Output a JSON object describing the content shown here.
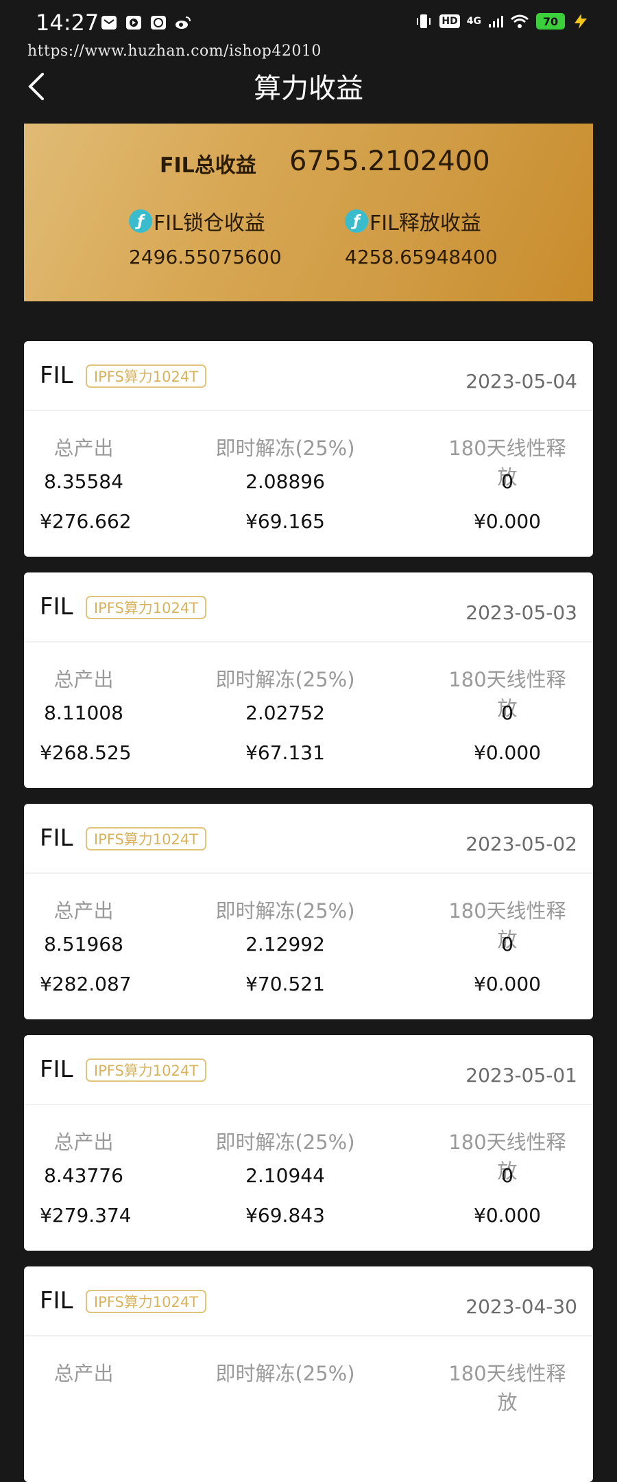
{
  "status_bar": {
    "time": "14:27",
    "signal_label": "4G",
    "hd_label": "HD",
    "battery": "70"
  },
  "watermark_url": "https://www.huzhan.com/ishop42010",
  "header": {
    "title": "算力收益"
  },
  "summary": {
    "total_label": "FIL总收益",
    "total_value": "6755.2102400",
    "locked_label": "FIL锁仓收益",
    "locked_value": "2496.55075600",
    "released_label": "FIL释放收益",
    "released_value": "4258.65948400",
    "coin_glyph": "ƒ"
  },
  "columns": {
    "total": "总产出",
    "instant": "即时解冻(25%)",
    "linear": "180天线性释放"
  },
  "cards": [
    {
      "coin": "FIL",
      "tag": "IPFS算力1024T",
      "date": "2023-05-04",
      "total": "8.35584",
      "instant": "2.08896",
      "linear": "0",
      "total_cny": "¥276.662",
      "instant_cny": "¥69.165",
      "linear_cny": "¥0.000"
    },
    {
      "coin": "FIL",
      "tag": "IPFS算力1024T",
      "date": "2023-05-03",
      "total": "8.11008",
      "instant": "2.02752",
      "linear": "0",
      "total_cny": "¥268.525",
      "instant_cny": "¥67.131",
      "linear_cny": "¥0.000"
    },
    {
      "coin": "FIL",
      "tag": "IPFS算力1024T",
      "date": "2023-05-02",
      "total": "8.51968",
      "instant": "2.12992",
      "linear": "0",
      "total_cny": "¥282.087",
      "instant_cny": "¥70.521",
      "linear_cny": "¥0.000"
    },
    {
      "coin": "FIL",
      "tag": "IPFS算力1024T",
      "date": "2023-05-01",
      "total": "8.43776",
      "instant": "2.10944",
      "linear": "0",
      "total_cny": "¥279.374",
      "instant_cny": "¥69.843",
      "linear_cny": "¥0.000"
    },
    {
      "coin": "FIL",
      "tag": "IPFS算力1024T",
      "date": "2023-04-30"
    }
  ],
  "colors": {
    "background": "#181818",
    "gold_start": "#e0bb75",
    "gold_end": "#c98c2c",
    "fil_coin": "#3bbccd",
    "tag": "#d9b25c"
  }
}
